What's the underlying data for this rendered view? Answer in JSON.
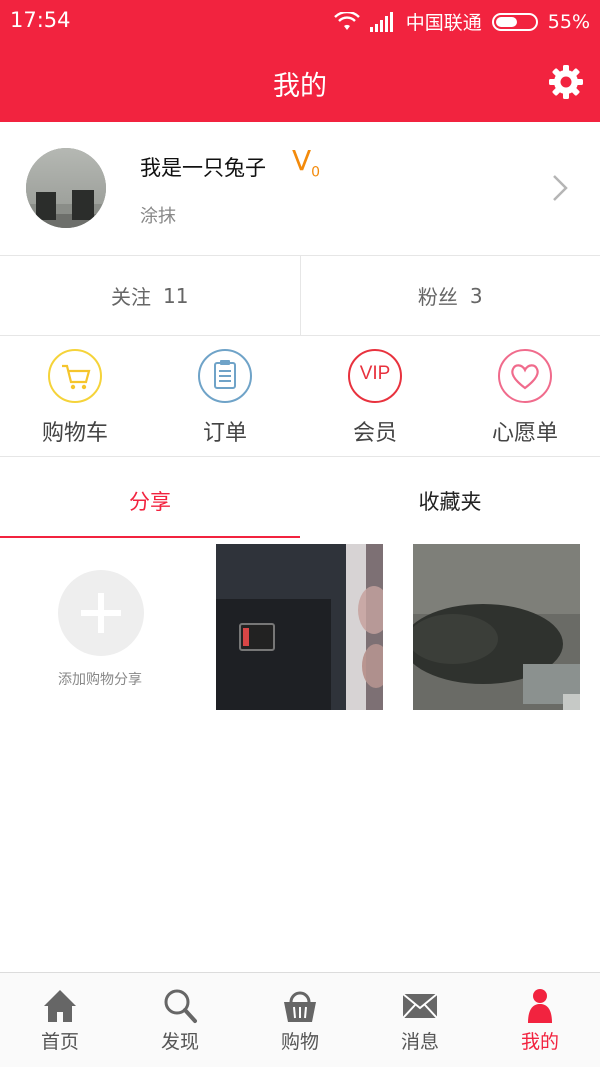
{
  "status_bar": {
    "time": "17:54",
    "carrier": "中国联通",
    "battery_text": "55%",
    "battery_level": 0.55
  },
  "header": {
    "title": "我的",
    "settings_icon": "gear-icon"
  },
  "profile": {
    "nickname": "我是一只兔子",
    "level_letter": "V",
    "level_num": "0",
    "signature": "涂抹"
  },
  "follow": [
    {
      "label": "关注",
      "count": "11"
    },
    {
      "label": "粉丝",
      "count": "3"
    }
  ],
  "quick_links": [
    {
      "label": "购物车",
      "icon": "cart-icon",
      "color": "#f5d33a"
    },
    {
      "label": "订单",
      "icon": "order-list-icon",
      "color": "#6fa3c8"
    },
    {
      "label": "会员",
      "icon": "vip-icon",
      "color": "#e8323e",
      "text": "VIP"
    },
    {
      "label": "心愿单",
      "icon": "heart-icon",
      "color": "#f06b8c"
    }
  ],
  "tabs": {
    "share": "分享",
    "favorites": "收藏夹"
  },
  "share_grid": {
    "add_label": "添加购物分享"
  },
  "bottom_nav": [
    {
      "label": "首页",
      "icon": "home-icon"
    },
    {
      "label": "发现",
      "icon": "search-icon"
    },
    {
      "label": "购物",
      "icon": "basket-icon"
    },
    {
      "label": "消息",
      "icon": "mail-icon"
    },
    {
      "label": "我的",
      "icon": "user-icon",
      "active": true
    }
  ],
  "colors": {
    "accent": "#f2233f",
    "level": "#f38a0b"
  }
}
